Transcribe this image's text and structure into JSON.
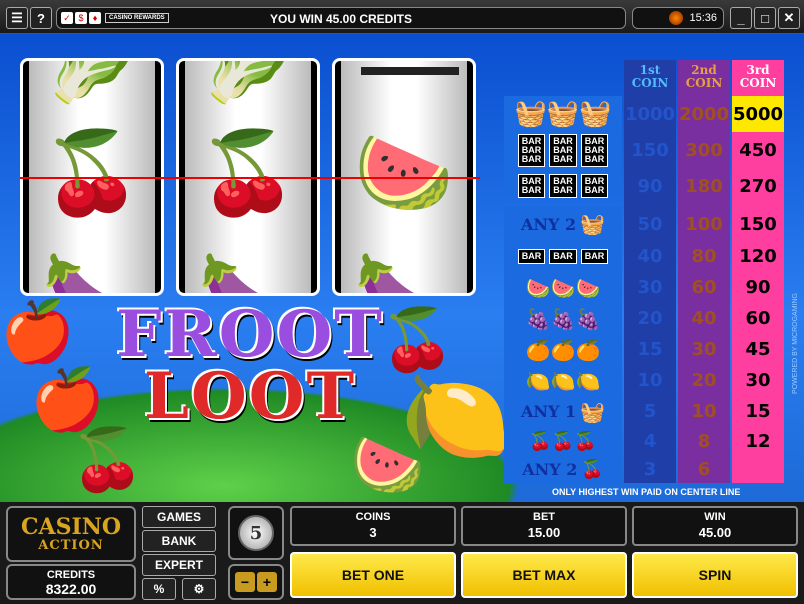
{
  "titlebar": {
    "menu_icon": "menu-icon",
    "help_label": "?",
    "rewards_label": "CASINO REWARDS",
    "status_message": "YOU WIN 45.00 CREDITS",
    "clock": "15:36"
  },
  "reels": [
    {
      "top": "leaf",
      "center": "cherries",
      "bottom": "plum"
    },
    {
      "top": "leaf",
      "center": "cherries",
      "bottom": "plum"
    },
    {
      "top": "blank",
      "center": "watermelon",
      "bottom": "plum"
    }
  ],
  "logo": {
    "line1": "FROOT",
    "line2": "LOOT"
  },
  "paytable": {
    "headers": [
      "1st COIN",
      "2nd COIN",
      "3rd COIN"
    ],
    "rows": [
      {
        "symbols": "fruit-basket x3",
        "label": "",
        "values": [
          "1000",
          "2000",
          "5000"
        ]
      },
      {
        "symbols": "triple-bar x3",
        "label": "",
        "values": [
          "150",
          "300",
          "450"
        ]
      },
      {
        "symbols": "double-bar x3",
        "label": "",
        "values": [
          "90",
          "180",
          "270"
        ]
      },
      {
        "symbols": "basket",
        "label": "ANY 2",
        "values": [
          "50",
          "100",
          "150"
        ]
      },
      {
        "symbols": "bar x3",
        "label": "",
        "values": [
          "40",
          "80",
          "120"
        ]
      },
      {
        "symbols": "watermelon x3",
        "label": "",
        "values": [
          "30",
          "60",
          "90"
        ]
      },
      {
        "symbols": "plum x3",
        "label": "",
        "values": [
          "20",
          "40",
          "60"
        ]
      },
      {
        "symbols": "orange x3",
        "label": "",
        "values": [
          "15",
          "30",
          "45"
        ]
      },
      {
        "symbols": "lemon x3",
        "label": "",
        "values": [
          "10",
          "20",
          "30"
        ]
      },
      {
        "symbols": "basket",
        "label": "ANY 1",
        "values": [
          "5",
          "10",
          "15"
        ]
      },
      {
        "symbols": "cherries x3",
        "label": "",
        "values": [
          "4",
          "8",
          "12"
        ]
      },
      {
        "symbols": "cherries",
        "label": "ANY 2",
        "values": [
          "3",
          "6",
          ""
        ]
      }
    ],
    "footnote": "ONLY HIGHEST WIN PAID ON CENTER LINE",
    "credit_text": "POWERED BY MICROGAMING"
  },
  "bar_label": "BAR",
  "panel": {
    "logo_line1": "CASINO",
    "logo_line2": "ACTION",
    "credits_label": "CREDITS",
    "credits_value": "8322.00",
    "menu": [
      "GAMES",
      "BANK",
      "EXPERT"
    ],
    "percent_label": "%",
    "coin_value": "5",
    "coins_label": "COINS",
    "coins_value": "3",
    "bet_label": "BET",
    "bet_value": "15.00",
    "win_label": "WIN",
    "win_value": "45.00",
    "bet_one_label": "BET ONE",
    "bet_max_label": "BET MAX",
    "spin_label": "SPIN"
  },
  "colors": {
    "col1": "#1f3ea8",
    "col2": "#7a2fa0",
    "col3": "#ff3fa0",
    "highlight": "#ffe800",
    "paytable_bg": "#1c6ae0"
  }
}
